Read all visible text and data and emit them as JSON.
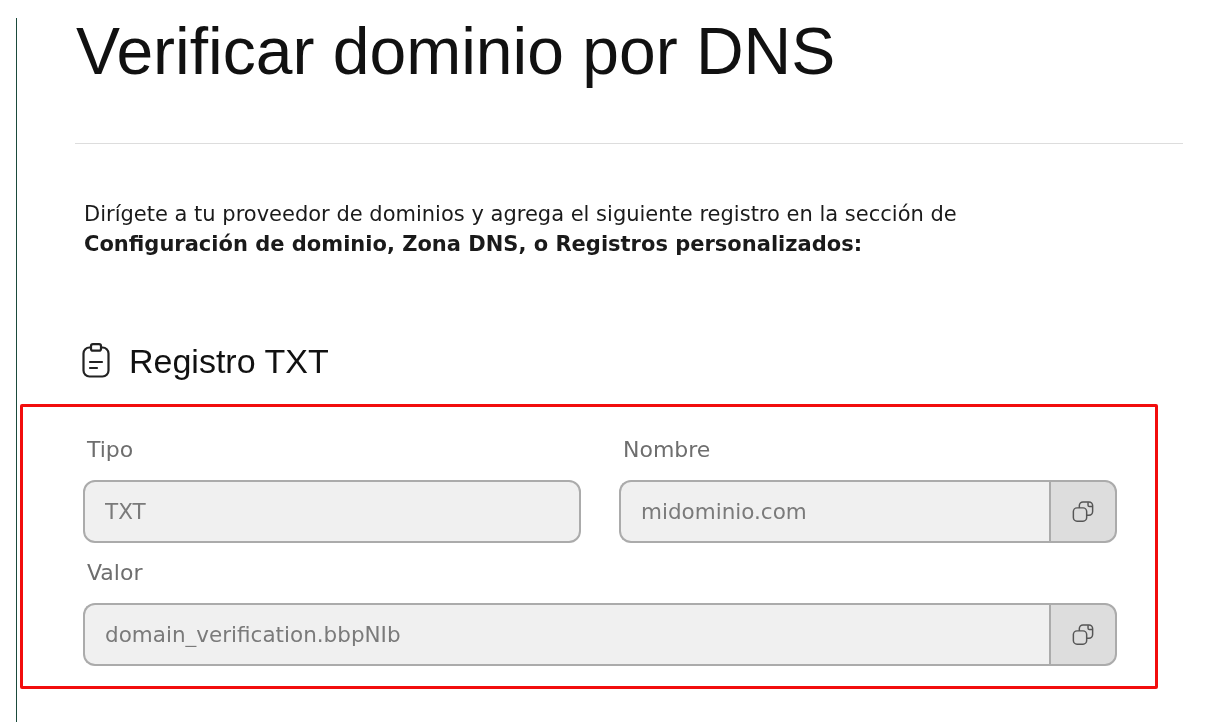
{
  "title": "Verificar dominio por DNS",
  "instructions": "Dirígete a tu proveedor de dominios y agrega el siguiente registro en la sección de\n**Configuración de dominio, Zona DNS, o Registros personalizados:**",
  "record": {
    "heading": "Registro TXT",
    "highlighted": true,
    "rows": [
      [
        {
          "label": "Tipo",
          "value": "TXT",
          "copyable": false
        },
        {
          "label": "Nombre",
          "value": "midominio.com",
          "copyable": true
        }
      ],
      [
        {
          "label": "Valor",
          "value": "domain_verification.bbpNIb",
          "copyable": true
        }
      ]
    ]
  }
}
